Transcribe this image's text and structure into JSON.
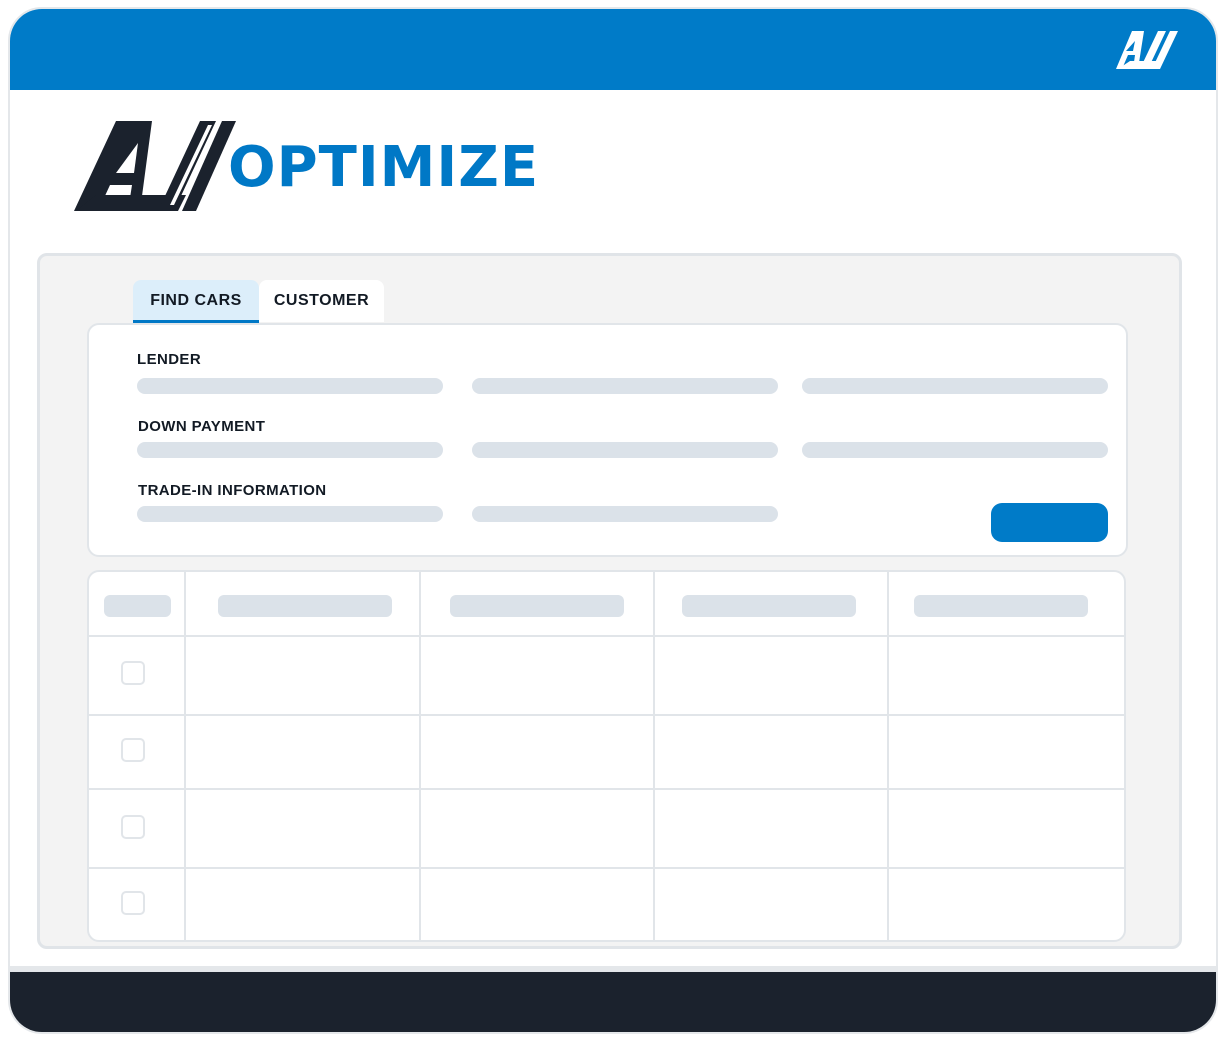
{
  "brand": {
    "logo_icon": "av-logo-mark",
    "name": "OPTIMIZE",
    "logo_color": "#1b222d",
    "accent_color": "#0078c6"
  },
  "tabs": {
    "find_cars": "FIND CARS",
    "customer": "CUSTOMER",
    "active": "FIND CARS"
  },
  "form": {
    "lender_label": "LENDER",
    "down_payment_label": "DOWN PAYMENT",
    "trade_in_label": "TRADE-IN INFORMATION"
  },
  "table": {
    "columns": 5,
    "rows": 4
  },
  "colors": {
    "topbar": "#007bc8",
    "footer": "#1b222d",
    "placeholder": "#dbe2e9"
  }
}
